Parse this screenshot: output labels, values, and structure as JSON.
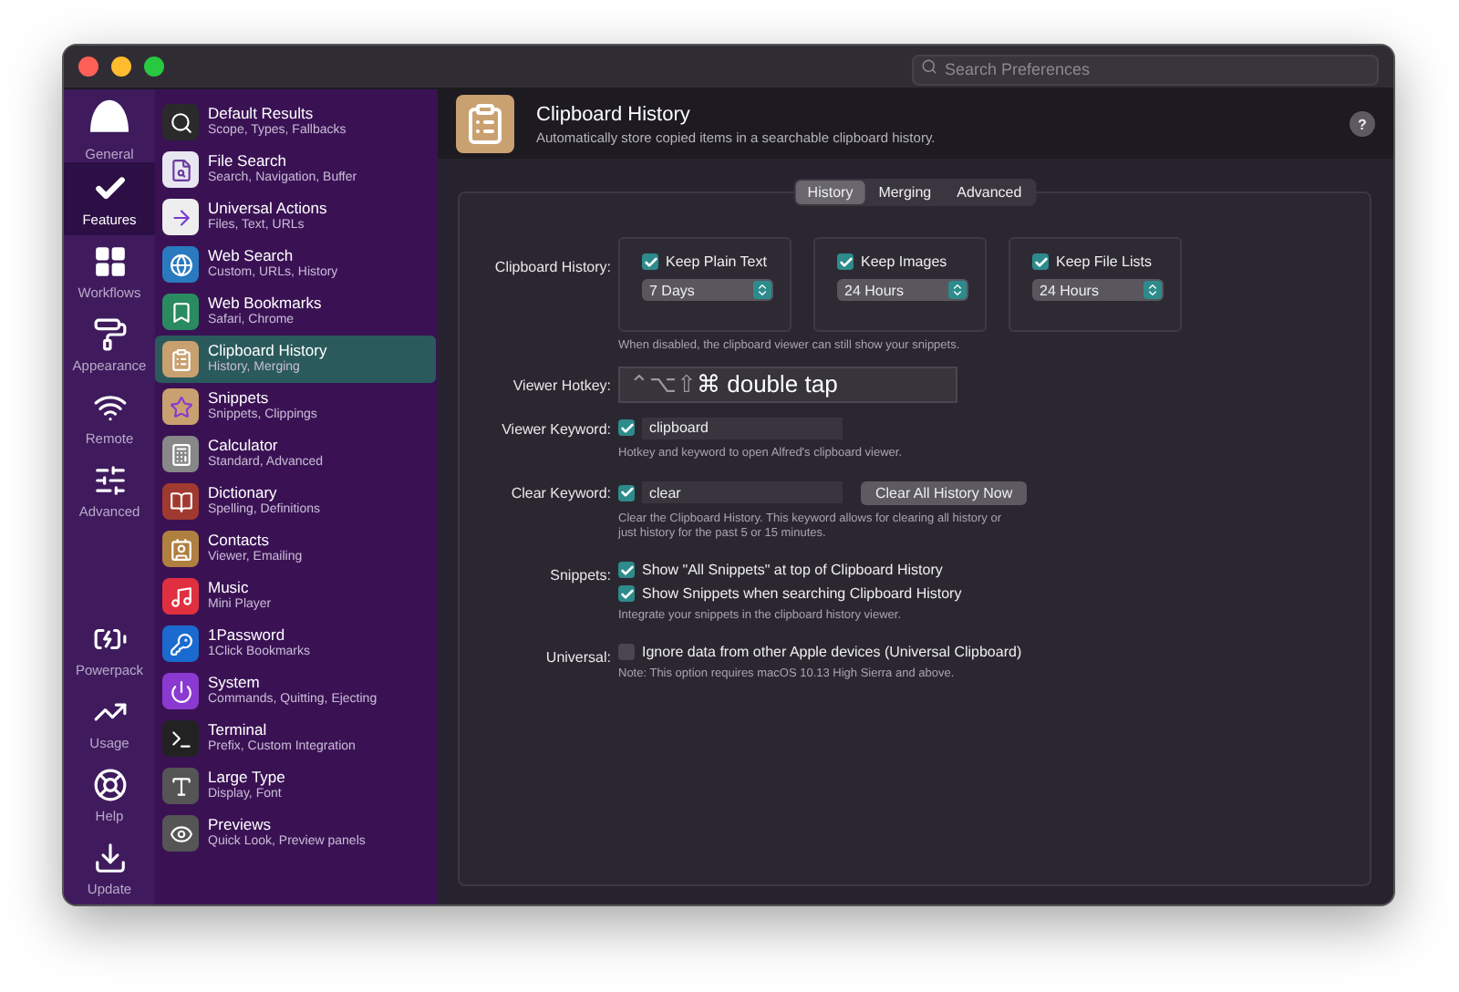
{
  "search": {
    "placeholder": "Search Preferences"
  },
  "nav_top": [
    {
      "label": "General",
      "selected": false
    },
    {
      "label": "Features",
      "selected": true
    },
    {
      "label": "Workflows",
      "selected": false
    },
    {
      "label": "Appearance",
      "selected": false
    },
    {
      "label": "Remote",
      "selected": false
    },
    {
      "label": "Advanced",
      "selected": false
    }
  ],
  "nav_bottom": [
    {
      "label": "Powerpack",
      "selected": false
    },
    {
      "label": "Usage",
      "selected": false
    },
    {
      "label": "Help",
      "selected": false
    },
    {
      "label": "Update",
      "selected": false
    }
  ],
  "features": [
    {
      "title": "Default Results",
      "subtitle": "Scope, Types, Fallbacks",
      "selected": false
    },
    {
      "title": "File Search",
      "subtitle": "Search, Navigation, Buffer",
      "selected": false
    },
    {
      "title": "Universal Actions",
      "subtitle": "Files, Text, URLs",
      "selected": false
    },
    {
      "title": "Web Search",
      "subtitle": "Custom, URLs, History",
      "selected": false
    },
    {
      "title": "Web Bookmarks",
      "subtitle": "Safari, Chrome",
      "selected": false
    },
    {
      "title": "Clipboard History",
      "subtitle": "History, Merging",
      "selected": true
    },
    {
      "title": "Snippets",
      "subtitle": "Snippets, Clippings",
      "selected": false
    },
    {
      "title": "Calculator",
      "subtitle": "Standard, Advanced",
      "selected": false
    },
    {
      "title": "Dictionary",
      "subtitle": "Spelling, Definitions",
      "selected": false
    },
    {
      "title": "Contacts",
      "subtitle": "Viewer, Emailing",
      "selected": false
    },
    {
      "title": "Music",
      "subtitle": "Mini Player",
      "selected": false
    },
    {
      "title": "1Password",
      "subtitle": "1Click Bookmarks",
      "selected": false
    },
    {
      "title": "System",
      "subtitle": "Commands, Quitting, Ejecting",
      "selected": false
    },
    {
      "title": "Terminal",
      "subtitle": "Prefix, Custom Integration",
      "selected": false
    },
    {
      "title": "Large Type",
      "subtitle": "Display, Font",
      "selected": false
    },
    {
      "title": "Previews",
      "subtitle": "Quick Look, Preview panels",
      "selected": false
    }
  ],
  "header": {
    "title": "Clipboard History",
    "subtitle": "Automatically store copied items in a searchable clipboard history.",
    "help": "?"
  },
  "tabs": [
    {
      "label": "History",
      "selected": true
    },
    {
      "label": "Merging",
      "selected": false
    },
    {
      "label": "Advanced",
      "selected": false
    }
  ],
  "history": {
    "label": "Clipboard History:",
    "note": "When disabled, the clipboard viewer can still show your snippets.",
    "options": [
      {
        "label": "Keep Plain Text",
        "checked": true,
        "value": "7 Days"
      },
      {
        "label": "Keep Images",
        "checked": true,
        "value": "24 Hours"
      },
      {
        "label": "Keep File Lists",
        "checked": true,
        "value": "24 Hours"
      }
    ]
  },
  "hotkey": {
    "label": "Viewer Hotkey:",
    "modifiers": "⌃⌥⇧",
    "key": "⌘ double tap"
  },
  "viewer_keyword": {
    "label": "Viewer Keyword:",
    "checked": true,
    "value": "clipboard",
    "note": "Hotkey and keyword to open Alfred's clipboard viewer."
  },
  "clear_keyword": {
    "label": "Clear Keyword:",
    "checked": true,
    "value": "clear",
    "button": "Clear All History Now",
    "note": "Clear the Clipboard History. This keyword allows for clearing all history or just history for the past 5 or 15 minutes."
  },
  "snippets": {
    "label": "Snippets:",
    "options": [
      {
        "label": "Show \"All Snippets\" at top of Clipboard History",
        "checked": true
      },
      {
        "label": "Show Snippets when searching Clipboard History",
        "checked": true
      }
    ],
    "note": "Integrate your snippets in the clipboard history viewer."
  },
  "universal": {
    "label": "Universal:",
    "options": [
      {
        "label": "Ignore data from other Apple devices (Universal Clipboard)",
        "checked": false
      }
    ],
    "note": "Note: This option requires macOS 10.13 High Sierra and above."
  }
}
